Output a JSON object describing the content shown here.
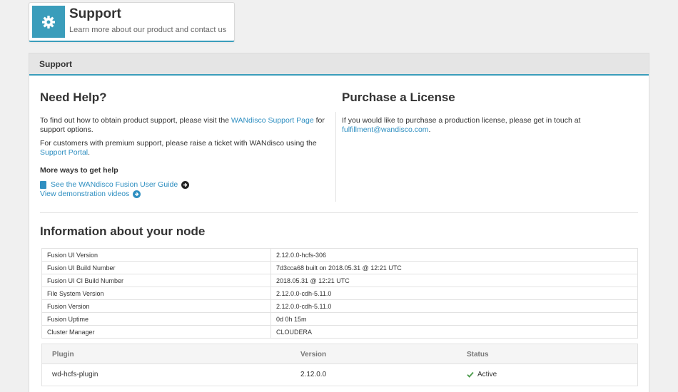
{
  "header": {
    "title": "Support",
    "subtitle": "Learn more about our product and contact us",
    "icon": "gear-icon"
  },
  "panel": {
    "title": "Support"
  },
  "help": {
    "title": "Need Help?",
    "p1_prefix": "To find out how to obtain product support, please visit the ",
    "p1_link": "WANdisco Support Page",
    "p1_suffix": " for support options.",
    "p2_prefix": "For customers with premium support, please raise a ticket with WANdisco using the ",
    "p2_link": "Support Portal",
    "p2_suffix": ".",
    "more_title": "More ways to get help",
    "guide_link": "See the WANdisco Fusion User Guide",
    "videos_link": "View demonstration videos"
  },
  "license": {
    "title": "Purchase a License",
    "text": "If you would like to purchase a production license, please get in touch at ",
    "email": "fulfillment@wandisco.com",
    "suffix": "."
  },
  "node": {
    "title": "Information about your node",
    "rows": [
      {
        "key": "Fusion UI Version",
        "value": "2.12.0.0-hcfs-306"
      },
      {
        "key": "Fusion UI Build Number",
        "value": "7d3cca68 built on 2018.05.31 @ 12:21 UTC"
      },
      {
        "key": "Fusion UI CI Build Number",
        "value": "2018.05.31 @ 12:21 UTC"
      },
      {
        "key": "File System Version",
        "value": "2.12.0.0-cdh-5.11.0"
      },
      {
        "key": "Fusion Version",
        "value": "2.12.0.0-cdh-5.11.0"
      },
      {
        "key": "Fusion Uptime",
        "value": "0d 0h 15m"
      },
      {
        "key": "Cluster Manager",
        "value": "CLOUDERA"
      }
    ]
  },
  "plugins": {
    "headers": {
      "plugin": "Plugin",
      "version": "Version",
      "status": "Status"
    },
    "rows": [
      {
        "plugin": "wd-hcfs-plugin",
        "version": "2.12.0.0",
        "status": "Active"
      }
    ]
  },
  "colors": {
    "accent": "#3a9dbb",
    "link": "#2f8fc1",
    "success": "#4a9a4a"
  }
}
